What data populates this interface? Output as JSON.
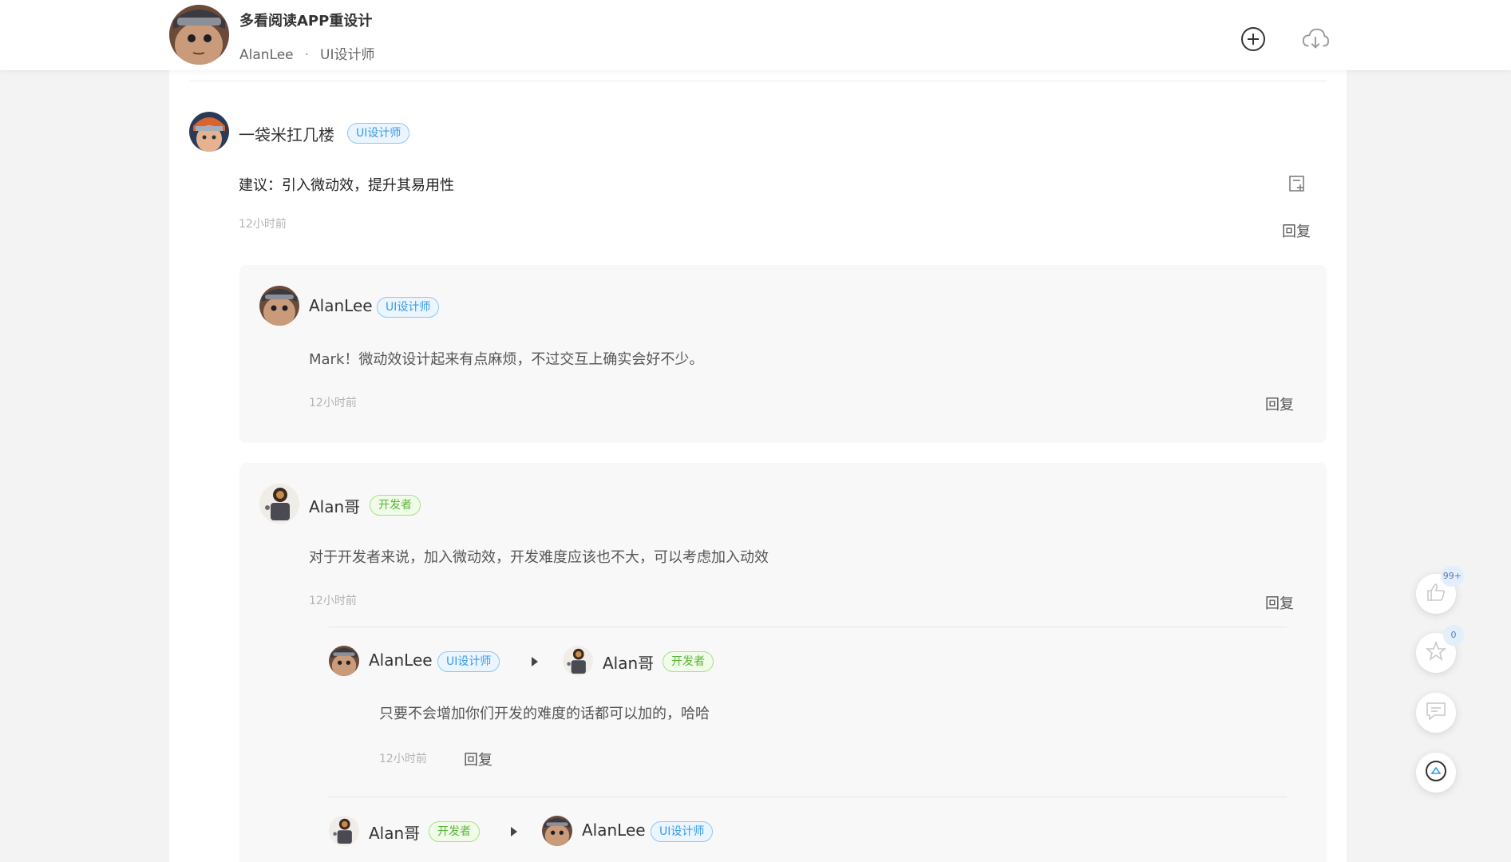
{
  "header": {
    "title": "多看阅读APP重设计",
    "author": "AlanLee",
    "separator": "·",
    "role": "UI设计师",
    "add_icon": "plus-circle-icon",
    "download_icon": "cloud-download-icon"
  },
  "comment": {
    "user": "一袋米扛几楼",
    "tag": "UI设计师",
    "text": "建议：引入微动效，提升其易用性",
    "time": "12小时前",
    "reply_label": "回复",
    "note_icon": "note-add-icon"
  },
  "replies": [
    {
      "user": "AlanLee",
      "tag": "UI设计师",
      "text": "Mark！微动效设计起来有点麻烦，不过交互上确实会好不少。",
      "time": "12小时前",
      "reply_label": "回复"
    },
    {
      "user": "Alan哥",
      "tag": "开发者",
      "text": "对于开发者来说，加入微动效，开发难度应该也不大，可以考虑加入动效",
      "time": "12小时前",
      "reply_label": "回复",
      "nested": [
        {
          "from": "AlanLee",
          "from_tag": "UI设计师",
          "to": "Alan哥",
          "to_tag": "开发者",
          "text": "只要不会增加你们开发的难度的话都可以加的，哈哈",
          "time": "12小时前",
          "reply_label": "回复"
        },
        {
          "from": "Alan哥",
          "from_tag": "开发者",
          "to": "AlanLee",
          "to_tag": "UI设计师"
        }
      ]
    }
  ],
  "floating": {
    "like_count": "99+",
    "favorite_count": "0",
    "like_icon": "thumbs-up-icon",
    "favorite_icon": "star-icon",
    "comment_icon": "comment-icon",
    "top_icon": "back-to-top-icon"
  },
  "colors": {
    "tag_blue": "#3a9be8",
    "tag_green": "#5bb43a",
    "background": "#f3f3f3"
  }
}
